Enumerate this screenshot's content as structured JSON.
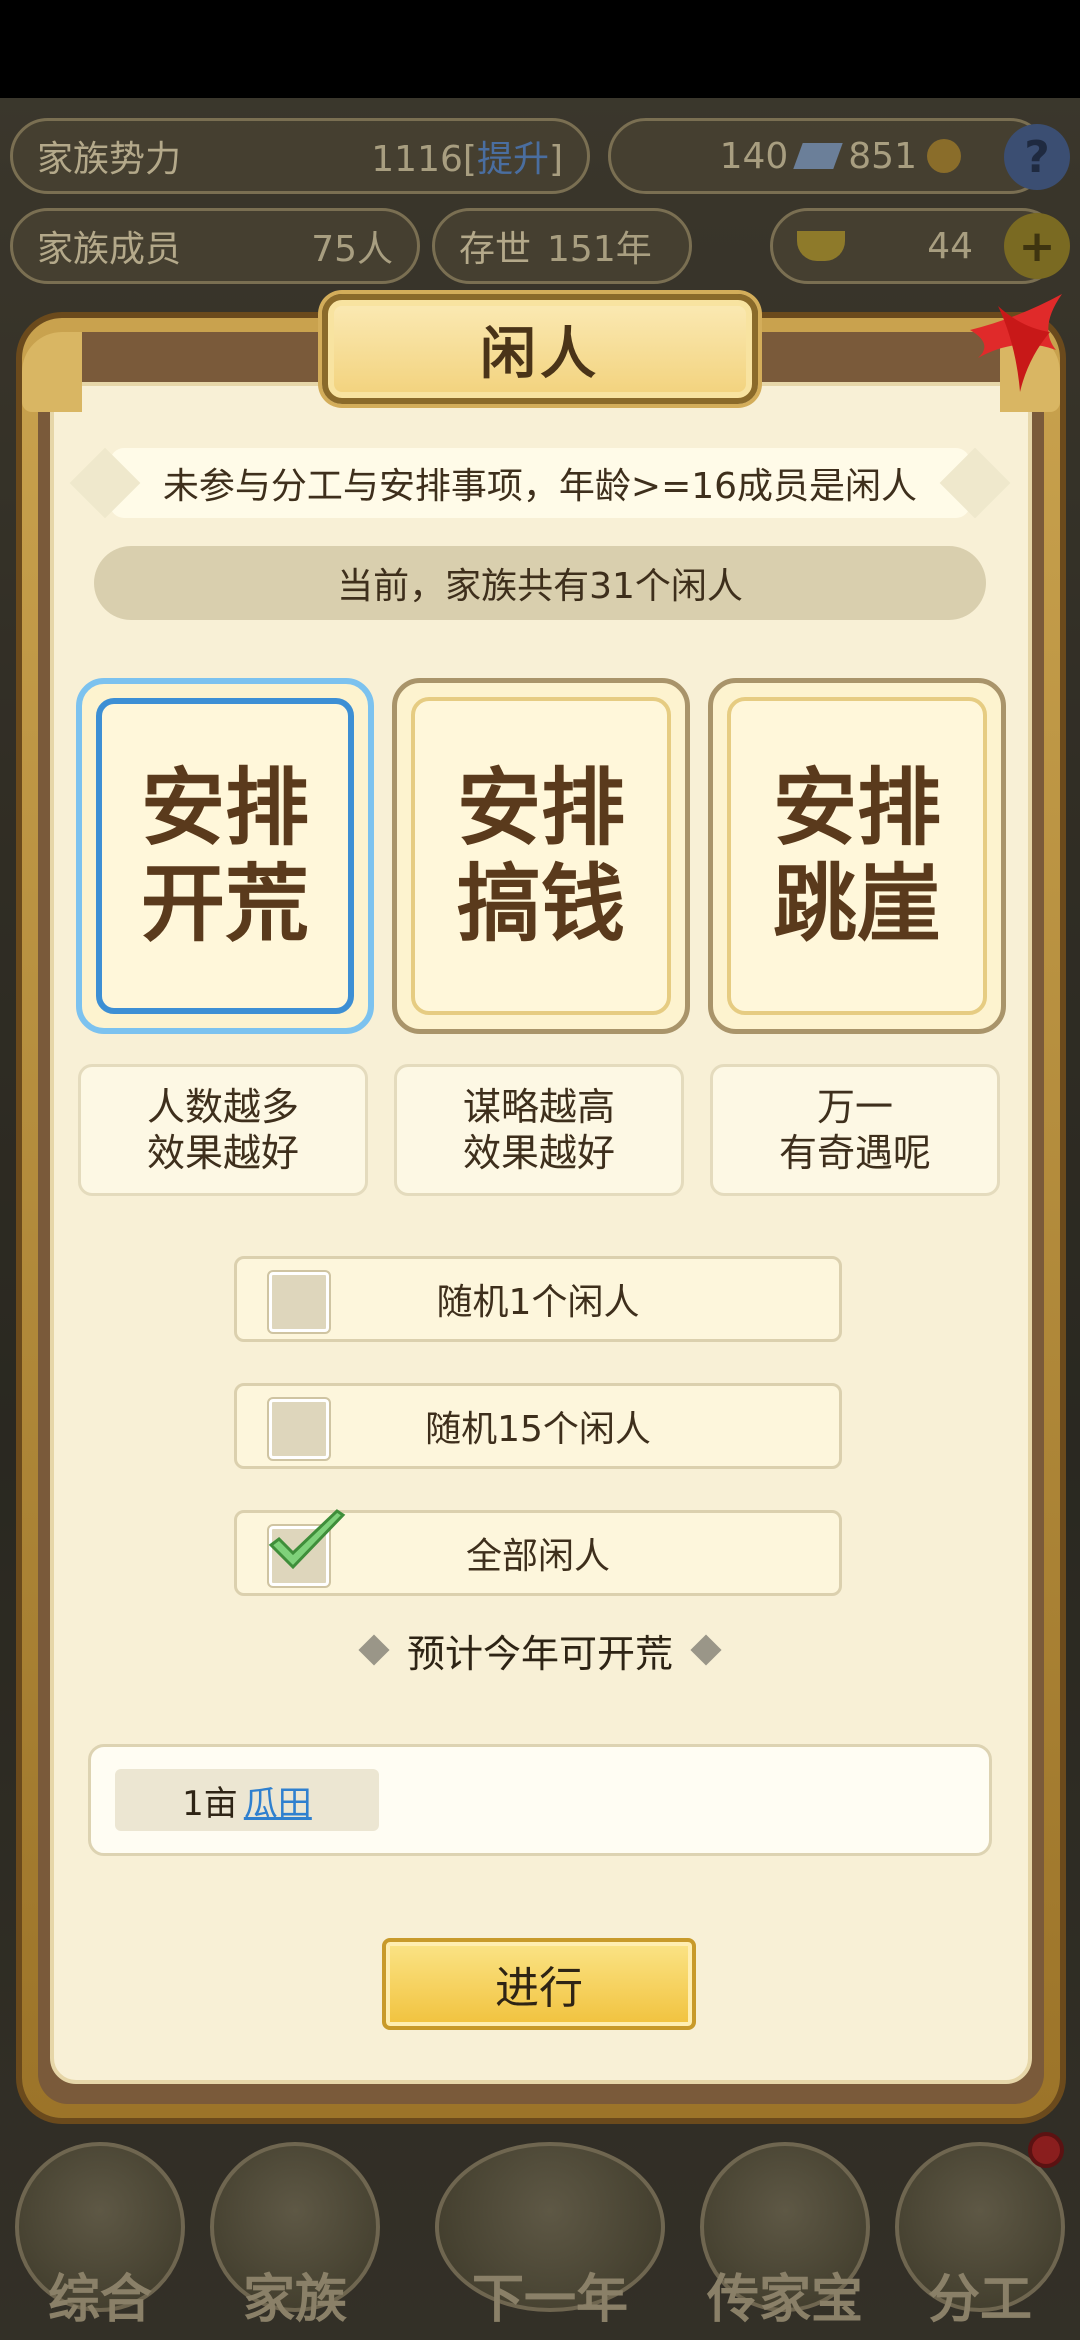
{
  "background": {
    "stats": {
      "power_label": "家族势力",
      "power_value": "1116[",
      "power_link": "提升",
      "power_close": "]",
      "resources": "140",
      "resources2": "851",
      "members_label": "家族成员",
      "members_value": "75人",
      "age_label": "存世",
      "age_value": "151年",
      "gold": "44"
    },
    "nav": [
      "综合",
      "家族",
      "下一年",
      "传家宝",
      "分工"
    ]
  },
  "modal": {
    "title": "闲人",
    "description": "未参与分工与安排事项，年龄>=16成员是闲人",
    "count_text": "当前，家族共有31个闲人",
    "options": [
      {
        "label_line1": "安排",
        "label_line2": "开荒",
        "hint_line1": "人数越多",
        "hint_line2": "效果越好",
        "selected": true
      },
      {
        "label_line1": "安排",
        "label_line2": "搞钱",
        "hint_line1": "谋略越高",
        "hint_line2": "效果越好",
        "selected": false
      },
      {
        "label_line1": "安排",
        "label_line2": "跳崖",
        "hint_line1": "万一",
        "hint_line2": "有奇遇呢",
        "selected": false
      }
    ],
    "choices": [
      {
        "label": "随机1个闲人",
        "checked": false
      },
      {
        "label": "随机15个闲人",
        "checked": false
      },
      {
        "label": "全部闲人",
        "checked": true
      }
    ],
    "estimate_label": "预计今年可开荒",
    "result": {
      "amount": "1亩",
      "item": "瓜田"
    },
    "go_button": "进行"
  },
  "colors": {
    "accent_blue": "#3d8fd4",
    "frame_gold": "#c9a24e",
    "button_gold": "#f1c23d",
    "link_blue": "#2f80cf"
  }
}
